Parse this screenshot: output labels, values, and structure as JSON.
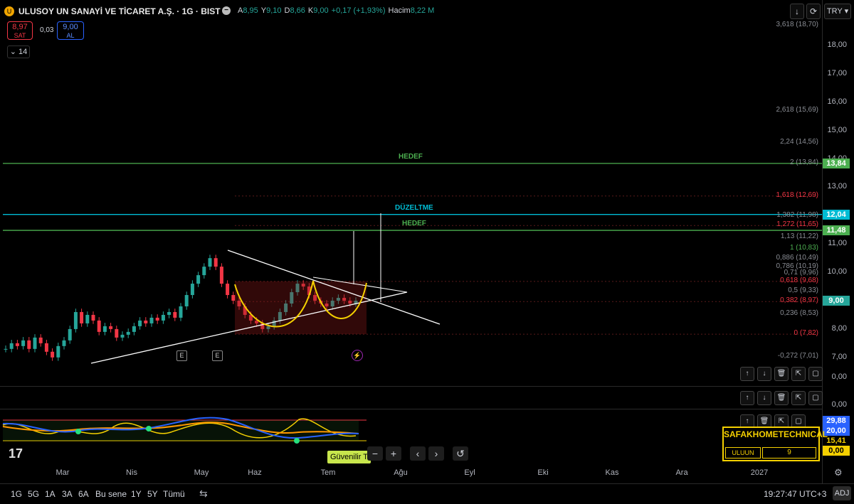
{
  "header": {
    "logo": "U",
    "title": "ULUSOY UN SANAYİ VE TİCARET A.Ş. · 1G · BIST",
    "hide_icon": "minus-circle-icon",
    "ohlc": [
      {
        "k": "A",
        "v": "8,95"
      },
      {
        "k": "Y",
        "v": "9,10"
      },
      {
        "k": "D",
        "v": "8,66"
      },
      {
        "k": "K",
        "v": "9,00"
      },
      {
        "k": "",
        "v": "+0,17 (+1,93%)"
      },
      {
        "k": "Hacim",
        "v": "8,22 M"
      }
    ],
    "currency": "TRY",
    "sell_price": "8,97",
    "sell_label": "SAT",
    "spread": "0,03",
    "buy_price": "9,00",
    "buy_label": "AL",
    "indicator_toggle": "14"
  },
  "colors": {
    "up": "#26a69a",
    "down": "#f23645",
    "fib_red": "#f23645",
    "fib_green": "#4caf50",
    "target_green": "#4caf50",
    "correction_blue": "#00bcd4",
    "cup_yellow": "#f5d000"
  },
  "price_axis": {
    "ticks": [
      "18,00",
      "17,00",
      "16,00",
      "15,00",
      "14,00",
      "13,00",
      "12,00",
      "11,00",
      "10,00",
      "9,00",
      "8,00",
      "7,00"
    ]
  },
  "badges": {
    "hedef_high": "13,84",
    "duzeltme": "12,04",
    "hedef_low": "11,48",
    "last": "9,00"
  },
  "fib_levels": [
    {
      "label": "3,618 (18,70)",
      "price": 18.7,
      "color": "grey"
    },
    {
      "label": "2,618 (15,69)",
      "price": 15.69,
      "color": "grey"
    },
    {
      "label": "2,24 (14,56)",
      "price": 14.56,
      "color": "grey"
    },
    {
      "label": "2 (13,84)",
      "price": 13.84,
      "color": "grey"
    },
    {
      "label": "1,618 (12,69)",
      "price": 12.69,
      "color": "red"
    },
    {
      "label": "1,382 (11,98)",
      "price": 11.98,
      "color": "grey"
    },
    {
      "label": "1,272 (11,65)",
      "price": 11.65,
      "color": "red"
    },
    {
      "label": "1,13 (11,22)",
      "price": 11.22,
      "color": "grey"
    },
    {
      "label": "1 (10,83)",
      "price": 10.83,
      "color": "green"
    },
    {
      "label": "0,886 (10,49)",
      "price": 10.49,
      "color": "grey"
    },
    {
      "label": "0,786 (10,19)",
      "price": 10.19,
      "color": "grey"
    },
    {
      "label": "0,71 (9,96)",
      "price": 9.96,
      "color": "grey"
    },
    {
      "label": "0,618 (9,68)",
      "price": 9.68,
      "color": "red"
    },
    {
      "label": "0,5 (9,33)",
      "price": 9.33,
      "color": "grey"
    },
    {
      "label": "0,382 (8,97)",
      "price": 8.97,
      "color": "red"
    },
    {
      "label": "0,236 (8,53)",
      "price": 8.53,
      "color": "grey"
    },
    {
      "label": "0 (7,82)",
      "price": 7.82,
      "color": "red"
    },
    {
      "label": "-0,272 (7,01)",
      "price": 7.01,
      "color": "grey"
    }
  ],
  "annotations": {
    "hedef_top": "HEDEF",
    "duzeltme": "DÜZELTME",
    "hedef_low": "HEDEF",
    "earnings": "E"
  },
  "chart_data": {
    "type": "candlestick",
    "title": "ULUSOY UN SANAYİ VE TİCARET A.Ş. · 1G · BIST",
    "ylim": [
      6.8,
      19.0
    ],
    "ohlc_close_path": [
      7.3,
      7.5,
      7.4,
      7.6,
      7.3,
      7.7,
      7.5,
      7.2,
      7.0,
      7.4,
      7.6,
      8.0,
      8.6,
      8.2,
      8.5,
      8.3,
      7.9,
      8.1,
      8.0,
      7.7,
      7.8,
      7.9,
      8.1,
      8.3,
      8.2,
      8.4,
      8.3,
      8.5,
      8.6,
      8.4,
      8.8,
      9.2,
      9.6,
      9.9,
      10.2,
      10.5,
      10.2,
      9.6,
      9.2,
      9.0,
      8.8,
      8.5,
      8.3,
      8.2,
      8.0,
      8.1,
      8.3,
      8.6,
      8.9,
      9.3,
      9.6,
      9.5,
      9.2,
      9.0,
      8.9,
      8.8,
      9.0,
      9.1,
      9.0,
      8.9,
      9.0
    ],
    "last_close": 9.0,
    "grid": false
  },
  "indicator": {
    "name": "SAFAKHOMETECHNICAL",
    "key": "ULUUN",
    "value": "9",
    "axis_labels": [
      "0,00",
      "0,00"
    ],
    "badges": [
      {
        "v": "29,88",
        "bg": "#2962ff",
        "fg": "#fff"
      },
      {
        "v": "20,00",
        "bg": "#2962ff",
        "fg": "#fff"
      },
      {
        "v": "15,41",
        "bg": "#000",
        "fg": "#f5d000"
      },
      {
        "v": "0,00",
        "bg": "#f5d000",
        "fg": "#000"
      }
    ]
  },
  "pane_controls": [
    "arrow-up-icon",
    "arrow-down-icon",
    "trash-icon",
    "collapse-icon",
    "reset-icon"
  ],
  "timeline": {
    "months": [
      "Mar",
      "Nis",
      "May",
      "Haz",
      "Tem",
      "Ağu",
      "Eyl",
      "Eki",
      "Kas",
      "Ara",
      "2027"
    ]
  },
  "zoom_controls": {
    "minus": "−",
    "plus": "+",
    "left": "‹",
    "right": "›",
    "reset": "↺"
  },
  "tooltip": "Güvenilir T",
  "footer": {
    "timeframes": [
      "1G",
      "5G",
      "1A",
      "3A",
      "6A",
      "Bu sene",
      "1Y",
      "5Y",
      "Tümü"
    ],
    "time": "19:27:47 UTC+3",
    "adj": "ADJ"
  }
}
